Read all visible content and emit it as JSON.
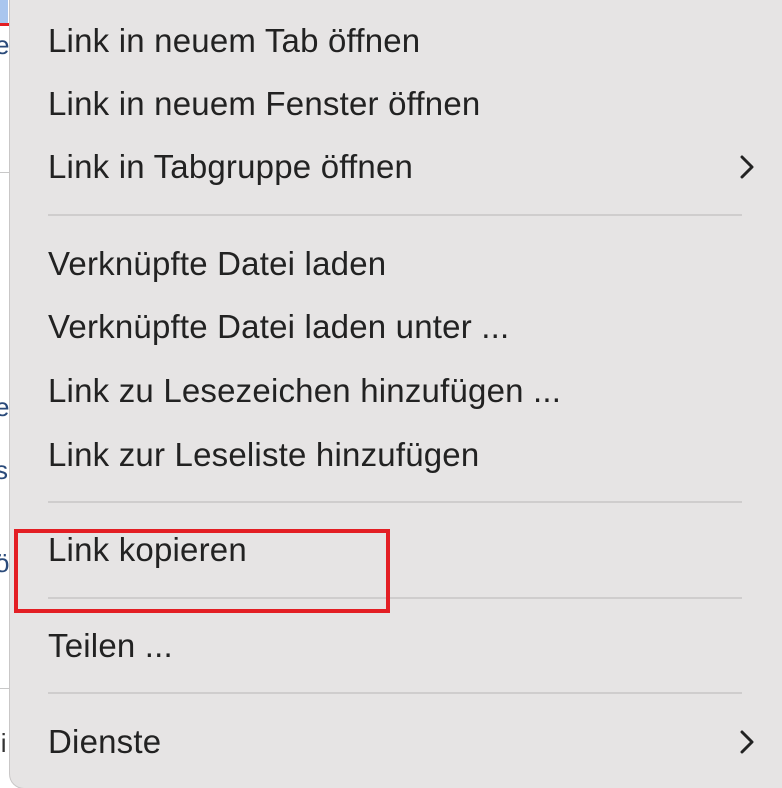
{
  "background_fragments": [
    "e",
    "l",
    "e",
    "s",
    "ö",
    "li"
  ],
  "menu": {
    "items": [
      {
        "label": "Link in neuem Tab öffnen"
      },
      {
        "label": "Link in neuem Fenster öffnen"
      },
      {
        "label": "Link in Tabgruppe öffnen",
        "submenu_icon": "chevron-right-icon"
      },
      {
        "label": "Verknüpfte Datei laden"
      },
      {
        "label": "Verknüpfte Datei laden unter ..."
      },
      {
        "label": "Link zu Lesezeichen hinzufügen ..."
      },
      {
        "label": "Link zur Leseliste hinzufügen"
      },
      {
        "label": "Link kopieren",
        "highlighted": true
      },
      {
        "label": "Teilen ..."
      },
      {
        "label": "Dienste",
        "submenu_icon": "chevron-right-icon"
      }
    ]
  },
  "colors": {
    "menu_background": "#e6e4e4",
    "text": "#222222",
    "separator": "#cfcdcd",
    "highlight_border": "#e31e24"
  }
}
